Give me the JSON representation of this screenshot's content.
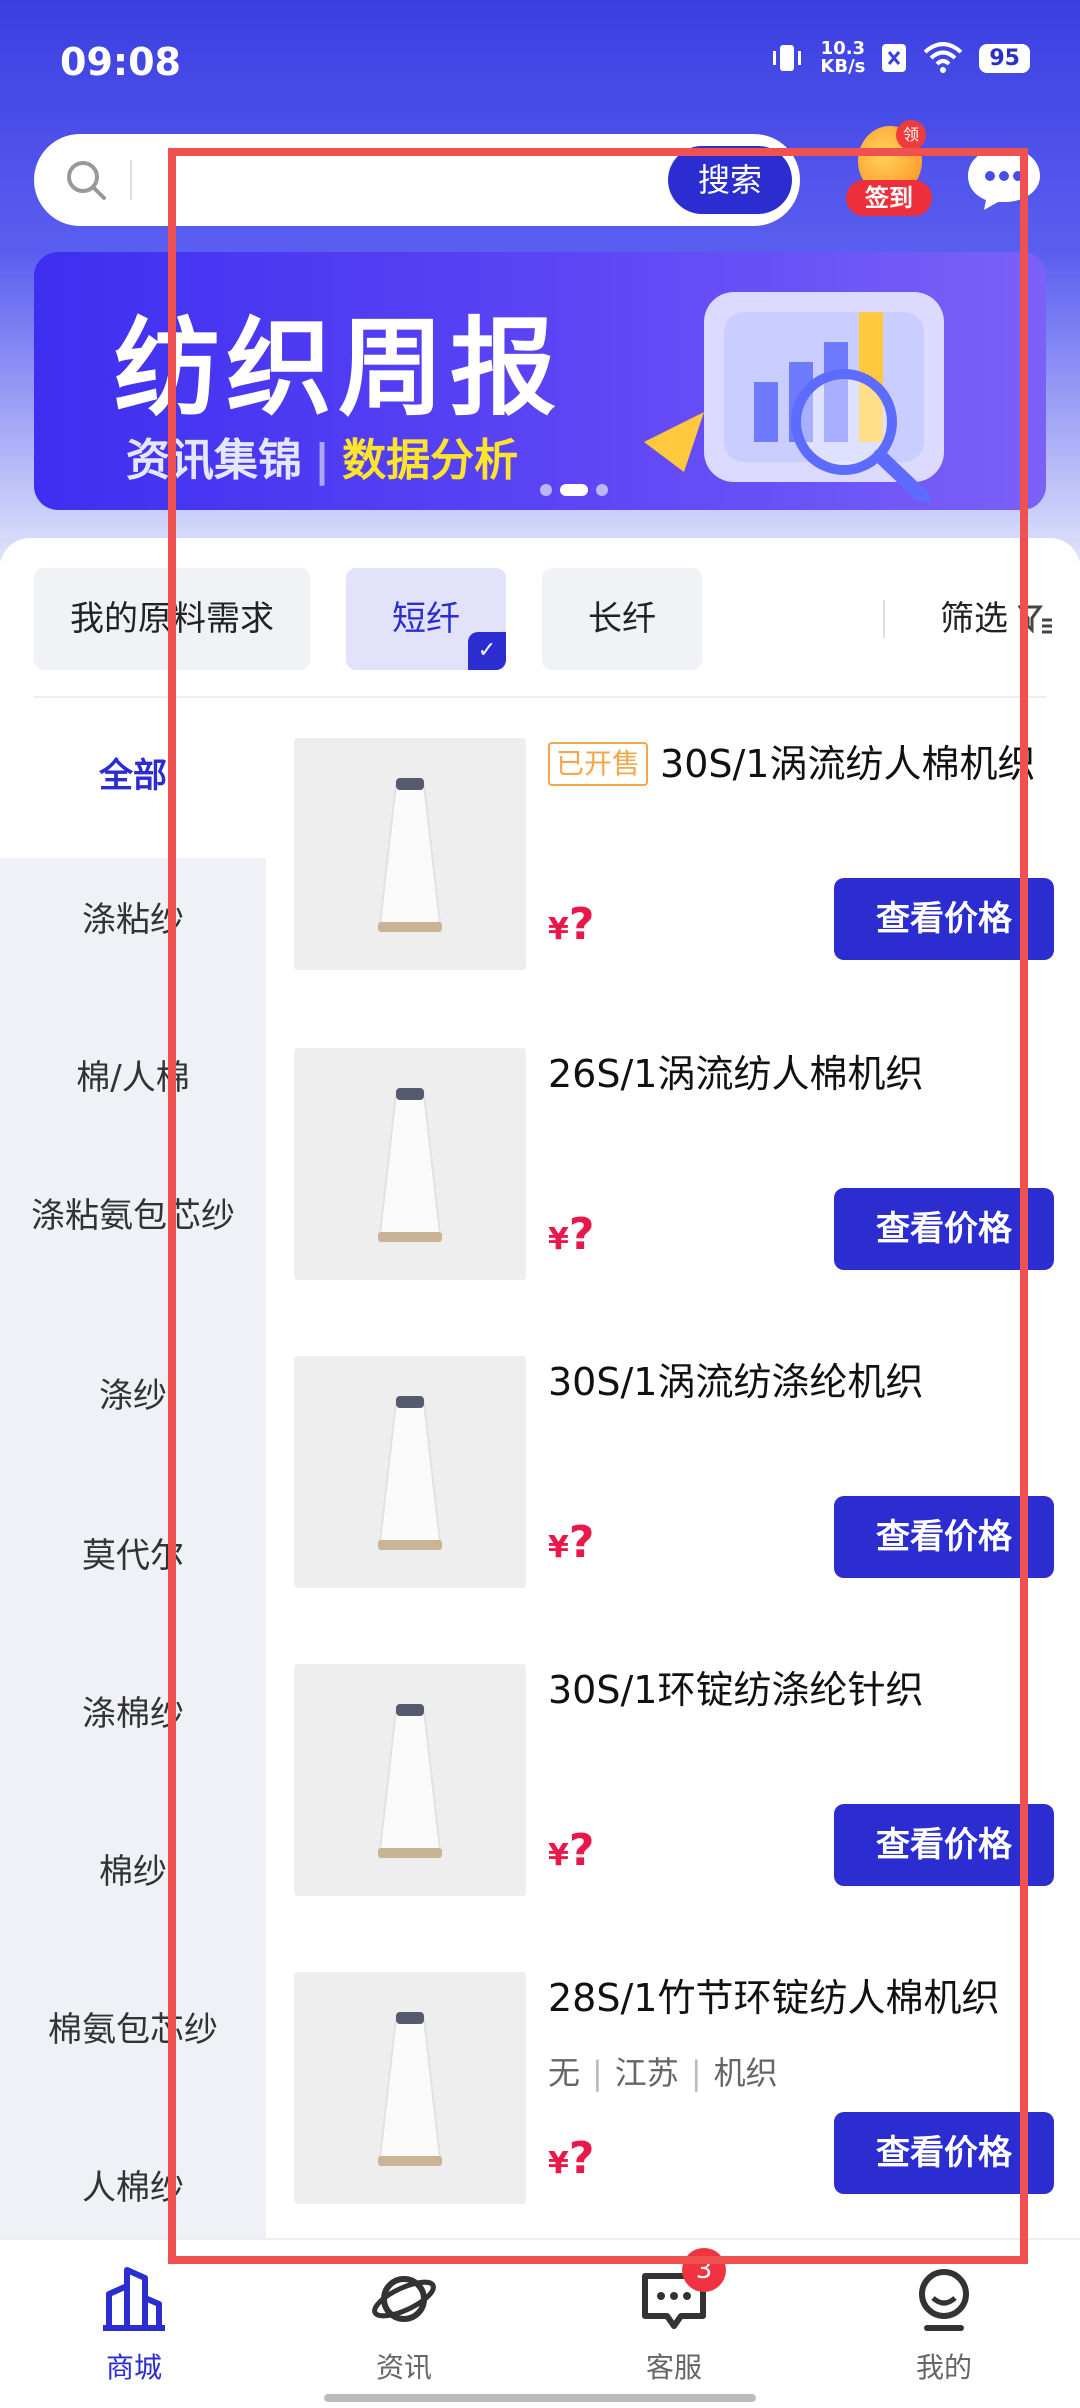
{
  "status_bar": {
    "time": "09:08",
    "speed_value": "10.3",
    "speed_unit": "KB/s",
    "battery": "95"
  },
  "search": {
    "placeholder": "",
    "button_label": "搜索"
  },
  "signin": {
    "badge": "领",
    "label": "签到"
  },
  "banner": {
    "title": "纺织周报",
    "subtitle_left": "资讯集锦",
    "subtitle_right": "数据分析"
  },
  "chips": [
    {
      "label": "我的原料需求",
      "selected": false
    },
    {
      "label": "短纤",
      "selected": true
    },
    {
      "label": "长纤",
      "selected": false
    }
  ],
  "filter_label": "筛选",
  "sidebar": {
    "items": [
      {
        "label": "全部",
        "active": true
      },
      {
        "label": "涤粘纱",
        "active": false
      },
      {
        "label": "棉/人棉",
        "active": false
      },
      {
        "label": "涤粘氨包芯纱",
        "active": false
      },
      {
        "label": "涤纱",
        "active": false
      },
      {
        "label": "莫代尔",
        "active": false
      },
      {
        "label": "涤棉纱",
        "active": false
      },
      {
        "label": "棉纱",
        "active": false
      },
      {
        "label": "棉氨包芯纱",
        "active": false
      },
      {
        "label": "人棉纱",
        "active": false
      }
    ]
  },
  "products": [
    {
      "tag": "已开售",
      "title": "30S/1涡流纺人棉机织",
      "meta": null,
      "price_symbol": "¥",
      "price": "?",
      "button": "查看价格"
    },
    {
      "tag": null,
      "title": "26S/1涡流纺人棉机织",
      "meta": null,
      "price_symbol": "¥",
      "price": "?",
      "button": "查看价格"
    },
    {
      "tag": null,
      "title": "30S/1涡流纺涤纶机织",
      "meta": null,
      "price_symbol": "¥",
      "price": "?",
      "button": "查看价格"
    },
    {
      "tag": null,
      "title": "30S/1环锭纺涤纶针织",
      "meta": null,
      "price_symbol": "¥",
      "price": "?",
      "button": "查看价格"
    },
    {
      "tag": null,
      "title": "28S/1竹节环锭纺人棉机织",
      "meta": [
        "无",
        "江苏",
        "机织"
      ],
      "price_symbol": "¥",
      "price": "?",
      "button": "查看价格"
    }
  ],
  "bottom_nav": {
    "items": [
      {
        "label": "商城",
        "icon": "building-icon",
        "active": true
      },
      {
        "label": "资讯",
        "icon": "planet-icon",
        "active": false
      },
      {
        "label": "客服",
        "icon": "chat-bubble-icon",
        "active": false,
        "badge": "3"
      },
      {
        "label": "我的",
        "icon": "profile-icon",
        "active": false
      }
    ]
  },
  "colors": {
    "brand": "#2c2dd0",
    "price": "#e8194a",
    "highlight": "#ef5150",
    "tag": "#f1a84a"
  }
}
